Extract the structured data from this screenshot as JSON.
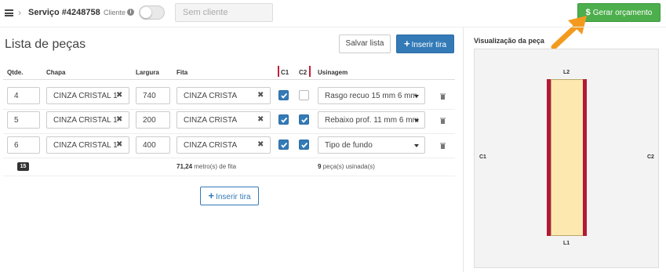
{
  "topbar": {
    "service_title": "Serviço #4248758",
    "client_label": "Cliente",
    "client_placeholder": "Sem cliente",
    "quote_button": "Gerar orçamento",
    "quote_symbol": "$"
  },
  "list": {
    "title": "Lista de peças",
    "save_button": "Salvar lista",
    "insert_button": "Inserir tira",
    "columns": {
      "qty": "Qtde.",
      "sheet": "Chapa",
      "width": "Largura",
      "tape": "Fita",
      "c1": "C1",
      "c2": "C2",
      "machining": "Usinagem"
    },
    "rows": [
      {
        "qty": "4",
        "sheet": "CINZA CRISTAL 1",
        "width": "740",
        "tape": "CINZA CRISTA",
        "c1": true,
        "c2": false,
        "machining": "Rasgo recuo 15 mm 6 mm"
      },
      {
        "qty": "5",
        "sheet": "CINZA CRISTAL 1",
        "width": "200",
        "tape": "CINZA CRISTA",
        "c1": true,
        "c2": true,
        "machining": "Rebaixo prof. 11 mm 6 mm"
      },
      {
        "qty": "6",
        "sheet": "CINZA CRISTAL 1",
        "width": "400",
        "tape": "CINZA CRISTA",
        "c1": true,
        "c2": true,
        "machining": "Tipo de fundo"
      }
    ],
    "summary": {
      "count": "15",
      "tape_meters": "71,24",
      "tape_suffix": "metro(s) de fita",
      "machined_count": "9",
      "machined_suffix": "peça(s) usinada(s)"
    },
    "insert_button_bottom": "Inserir tira"
  },
  "preview": {
    "title": "Visualização da peça",
    "label_top": "L2",
    "label_bottom": "L1",
    "label_left": "C1",
    "label_right": "C2"
  },
  "colors": {
    "primary": "#337ab7",
    "success": "#4cae4c",
    "edge": "#b5173a",
    "piece": "#fde9b0",
    "arrow": "#f39a1e"
  }
}
